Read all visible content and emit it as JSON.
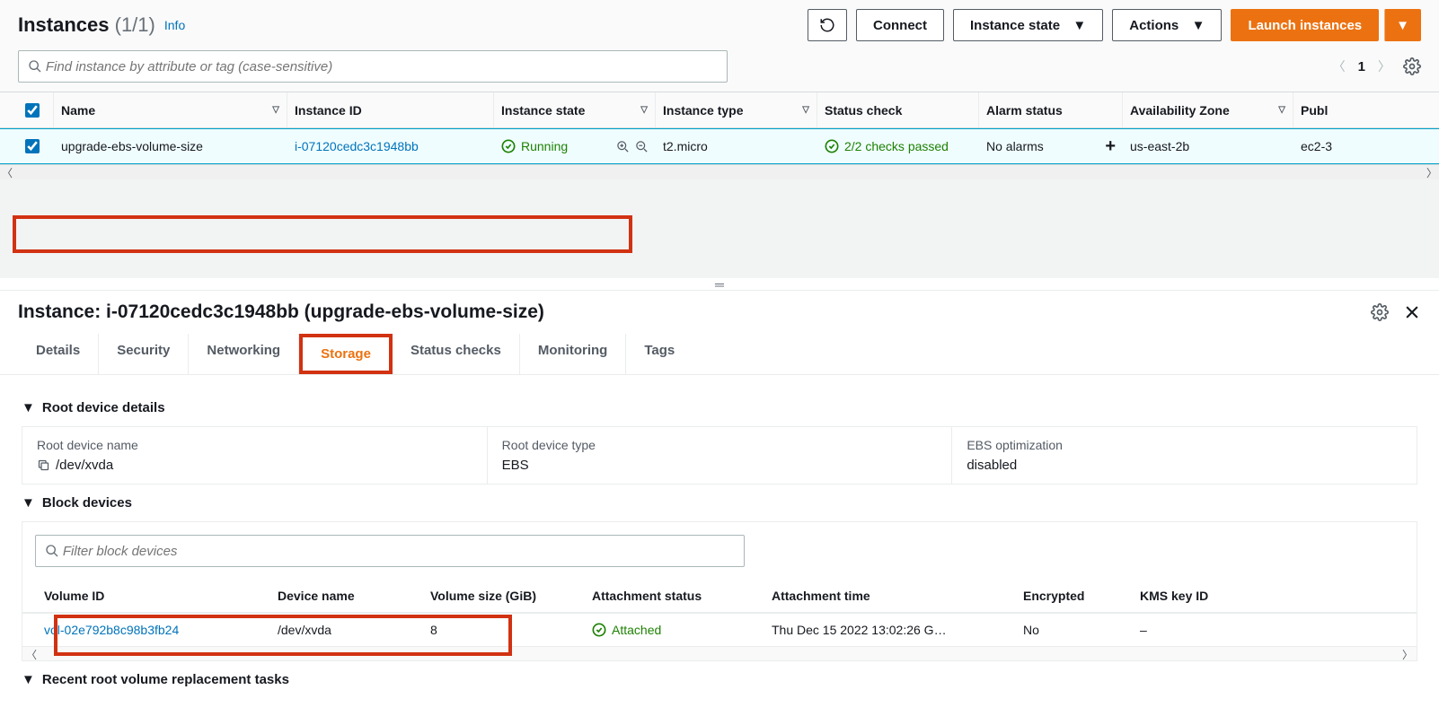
{
  "header": {
    "title": "Instances",
    "count": "(1/1)",
    "info": "Info",
    "refresh": "refresh",
    "connect": "Connect",
    "instance_state": "Instance state",
    "actions": "Actions",
    "launch": "Launch instances"
  },
  "search": {
    "placeholder": "Find instance by attribute or tag (case-sensitive)"
  },
  "pager": {
    "page": "1"
  },
  "columns": {
    "name": "Name",
    "instance_id": "Instance ID",
    "instance_state": "Instance state",
    "instance_type": "Instance type",
    "status_check": "Status check",
    "alarm_status": "Alarm status",
    "az": "Availability Zone",
    "dns": "Publ"
  },
  "row": {
    "name": "upgrade-ebs-volume-size",
    "instance_id": "i-07120cedc3c1948bb",
    "state": "Running",
    "type": "t2.micro",
    "status": "2/2 checks passed",
    "alarm": "No alarms",
    "az": "us-east-2b",
    "dns": "ec2-3"
  },
  "detail": {
    "title": "Instance: i-07120cedc3c1948bb (upgrade-ebs-volume-size)",
    "tabs": {
      "details": "Details",
      "security": "Security",
      "networking": "Networking",
      "storage": "Storage",
      "status": "Status checks",
      "monitoring": "Monitoring",
      "tags": "Tags"
    }
  },
  "root": {
    "section": "Root device details",
    "name_lbl": "Root device name",
    "name_val": "/dev/xvda",
    "type_lbl": "Root device type",
    "type_val": "EBS",
    "opt_lbl": "EBS optimization",
    "opt_val": "disabled"
  },
  "block": {
    "section": "Block devices",
    "filter_placeholder": "Filter block devices",
    "cols": {
      "vol": "Volume ID",
      "dev": "Device name",
      "size": "Volume size (GiB)",
      "att_status": "Attachment status",
      "att_time": "Attachment time",
      "enc": "Encrypted",
      "kms": "KMS key ID"
    },
    "row": {
      "vol": "vol-02e792b8c98b3fb24",
      "dev": "/dev/xvda",
      "size": "8",
      "att_status": "Attached",
      "att_time": "Thu Dec 15 2022 13:02:26 G…",
      "enc": "No",
      "kms": "–"
    }
  },
  "recent": {
    "section": "Recent root volume replacement tasks"
  }
}
